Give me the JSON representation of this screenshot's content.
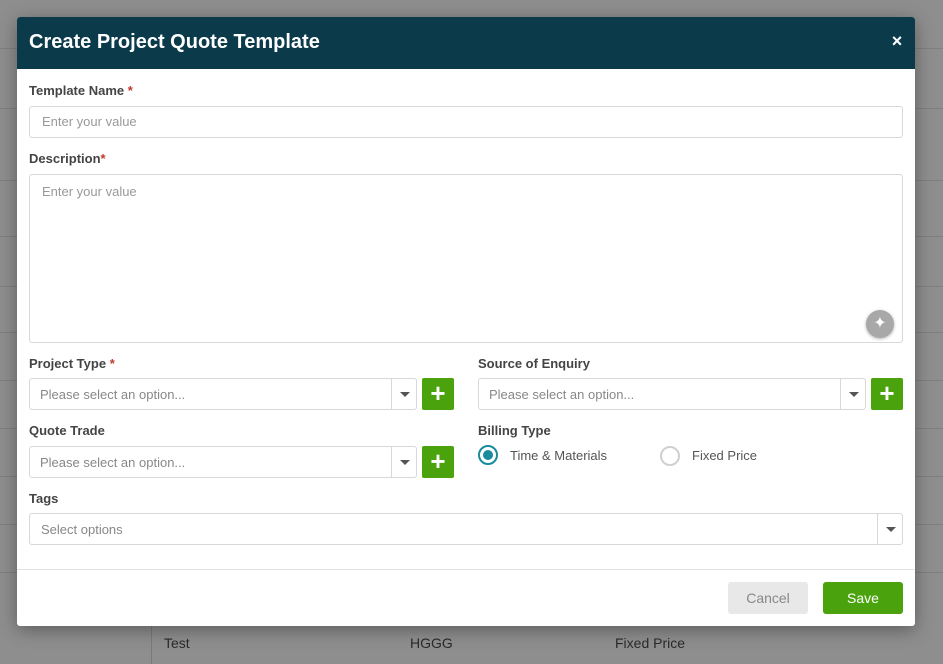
{
  "modal": {
    "title": "Create Project Quote Template",
    "close_icon": "×"
  },
  "form": {
    "template_name": {
      "label": "Template Name",
      "required_mark": "*",
      "placeholder": "Enter your value",
      "value": ""
    },
    "description": {
      "label": "Description",
      "required_mark": "*",
      "placeholder": "Enter your value",
      "value": "",
      "ai_icon": "sparkle-icon"
    },
    "project_type": {
      "label": "Project Type",
      "required_mark": "*",
      "placeholder": "Please select an option..."
    },
    "source_of_enquiry": {
      "label": "Source of Enquiry",
      "placeholder": "Please select an option..."
    },
    "quote_trade": {
      "label": "Quote Trade",
      "placeholder": "Please select an option..."
    },
    "billing_type": {
      "label": "Billing Type",
      "options": [
        {
          "label": "Time & Materials",
          "selected": true
        },
        {
          "label": "Fixed Price",
          "selected": false
        }
      ]
    },
    "tags": {
      "label": "Tags",
      "placeholder": "Select options"
    },
    "add_icon": "+"
  },
  "footer": {
    "cancel_label": "Cancel",
    "save_label": "Save"
  },
  "background_row": {
    "cells": [
      "Test",
      "HGGG",
      "Fixed Price"
    ]
  },
  "colors": {
    "header": "#0b3a4b",
    "accent_green": "#4aa30c",
    "radio_teal": "#1a8a9e"
  }
}
